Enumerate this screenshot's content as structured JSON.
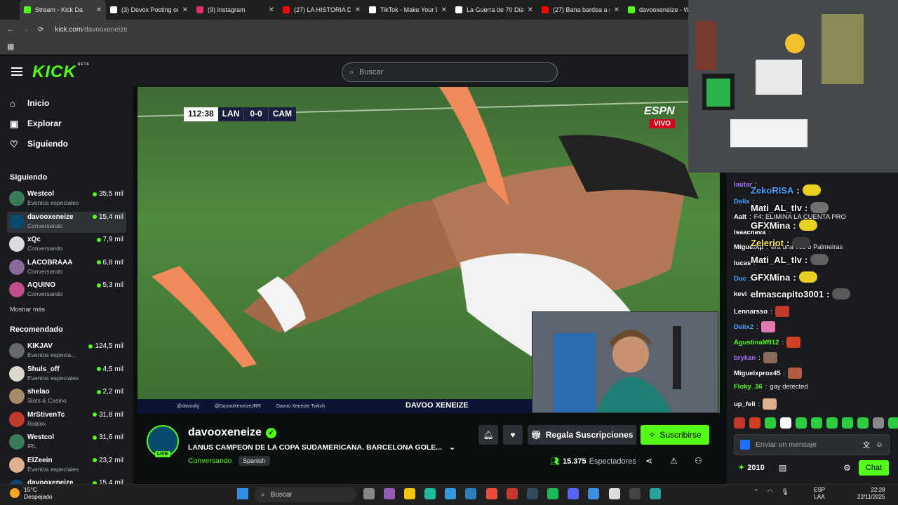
{
  "browser": {
    "tabs": [
      {
        "label": "Stream - Kick Da",
        "color": "#53fc18",
        "active": true
      },
      {
        "label": "(3) Devox Posting on",
        "color": "#ffffff"
      },
      {
        "label": "(9) Instagram",
        "color": "#e1306c"
      },
      {
        "label": "(27) LA HISTORIA DE",
        "color": "#ff0000"
      },
      {
        "label": "TikTok - Make Your D",
        "color": "#ffffff"
      },
      {
        "label": "La Guerra de 70 Días",
        "color": "#ffffff"
      },
      {
        "label": "(27) Bana bardea a m",
        "color": "#ff0000"
      },
      {
        "label": "davooxeneize - Wat",
        "color": "#53fc18"
      }
    ],
    "url_domain": "kick.com",
    "url_path": "/davooxeneize"
  },
  "header": {
    "logo": "KICK",
    "logo_badge": "BETA",
    "search_placeholder": "Buscar"
  },
  "sidebar": {
    "nav": [
      {
        "label": "Inicio",
        "icon": "home-icon"
      },
      {
        "label": "Explorar",
        "icon": "explore-icon"
      },
      {
        "label": "Siguiendo",
        "icon": "heart-icon"
      }
    ],
    "following_title": "Siguiendo",
    "following": [
      {
        "name": "Westcol",
        "category": "Eventos especiales",
        "viewers": "35,5 mil",
        "color": "#3b7a57"
      },
      {
        "name": "davooxeneize",
        "category": "Conversando",
        "viewers": "15,4 mil",
        "color": "#0a4a6e",
        "selected": true
      },
      {
        "name": "xQc",
        "category": "Conversando",
        "viewers": "7,9 mil",
        "color": "#dddddd"
      },
      {
        "name": "LACOBRAAA",
        "category": "Conversando",
        "viewers": "6,8 mil",
        "color": "#8a6a9a"
      },
      {
        "name": "AQUINO",
        "category": "Conversando",
        "viewers": "5,3 mil",
        "color": "#c04c8a"
      }
    ],
    "show_more": "Mostrar más",
    "recommended_title": "Recomendado",
    "recommended": [
      {
        "name": "KIKJAV",
        "category": "Eventos especia...",
        "viewers": "124,5 mil",
        "color": "#666a70"
      },
      {
        "name": "Shuls_off",
        "category": "Eventos especiales",
        "viewers": "4,5 mil",
        "color": "#ddd8cc"
      },
      {
        "name": "shelao",
        "category": "Slots & Casino",
        "viewers": "2,2 mil",
        "color": "#a68a6a"
      },
      {
        "name": "MrStivenTc",
        "category": "Roblox",
        "viewers": "31,8 mil",
        "color": "#c0392b"
      },
      {
        "name": "Westcol",
        "category": "IRL",
        "viewers": "31,6 mil",
        "color": "#3b7a57"
      },
      {
        "name": "ElZeein",
        "category": "Eventos especiales",
        "viewers": "23,2 mil",
        "color": "#e0b090"
      },
      {
        "name": "davooxeneize",
        "category": "",
        "viewers": "15,4 mil",
        "color": "#0a4a6e"
      }
    ]
  },
  "video": {
    "clock": "112:38",
    "team_home": "LAN",
    "score": "0-0",
    "team_away": "CAM",
    "network": "ESPN",
    "live_label": "VIVO",
    "overlay_items": [
      "@davoobj",
      "@DavooXeneizeJRR",
      "Davoo Xeneize Twitch"
    ],
    "overlay_brand": "DAVOO XENEIZE"
  },
  "stream": {
    "channel": "davooxeneize",
    "live_badge": "LIVE",
    "title": "LANUS CAMPEON DE LA COPA SUDAMERICANA. BARCELONA GOLE...",
    "category": "Conversando",
    "language": "Spanish",
    "viewers_count": "15.375",
    "viewers_label": "Espectadores",
    "gift_label": "Regala Suscripciones",
    "subscribe_label": "Suscribirse"
  },
  "chat": {
    "messages": [
      {
        "user": "lautar",
        "text": "",
        "color": "#a970ff"
      },
      {
        "user": "Delix",
        "text": "",
        "color": "#4fa3ff"
      },
      {
        "user": "Aalt",
        "text": "F4: ELIMINA LA CUENTA PRO",
        "color": "#ffffff"
      },
      {
        "user": "isaacnava",
        "text": "",
        "color": "#ffffff"
      },
      {
        "user": "MiguelXp",
        "text": "era una vez o Palmeiras",
        "color": "#ffffff"
      },
      {
        "user": "lucas",
        "text": "",
        "color": "#ffffff"
      },
      {
        "user": "Duc",
        "text": "",
        "color": "#4fa3ff"
      },
      {
        "user": "kevi",
        "text": "",
        "color": "#ffffff"
      },
      {
        "user": "Lennarsso",
        "text": "",
        "color": "#ffffff"
      },
      {
        "user": "Delix2",
        "text": "",
        "color": "#4fa3ff"
      },
      {
        "user": "AgustinaM912",
        "text": "",
        "color": "#53fc18"
      },
      {
        "user": "brykan",
        "text": "",
        "color": "#a970ff"
      },
      {
        "user": "Miguelxprox45",
        "text": "",
        "color": "#ffffff"
      },
      {
        "user": "Floky_36",
        "text": "gay detected",
        "color": "#53fc18"
      },
      {
        "user": "up_feli",
        "text": "",
        "color": "#ffffff"
      }
    ],
    "overlay_messages": [
      {
        "user": "ZekoRISA",
        "color": "#4fa3ff"
      },
      {
        "user": "Mati_AL_tlv",
        "color": "#ffffff"
      },
      {
        "user": "GFXMina",
        "color": "#ffffff"
      },
      {
        "user": "Zeleriot",
        "color": "#ffe66b"
      },
      {
        "user": "Mati_AL_tlv",
        "color": "#ffffff"
      },
      {
        "user": "GFXMina",
        "color": "#ffffff"
      },
      {
        "user": "elmasсapito3001",
        "color": "#ffffff"
      }
    ],
    "input_placeholder": "Enviar un mensaje",
    "points": "2010",
    "chat_button": "Chat"
  },
  "taskbar": {
    "temperature": "15°C",
    "weather": "Despejado",
    "search": "Buscar",
    "lang_top": "ESP",
    "lang_bottom": "LAA",
    "time": "22:28",
    "date": "22/11/2025"
  }
}
